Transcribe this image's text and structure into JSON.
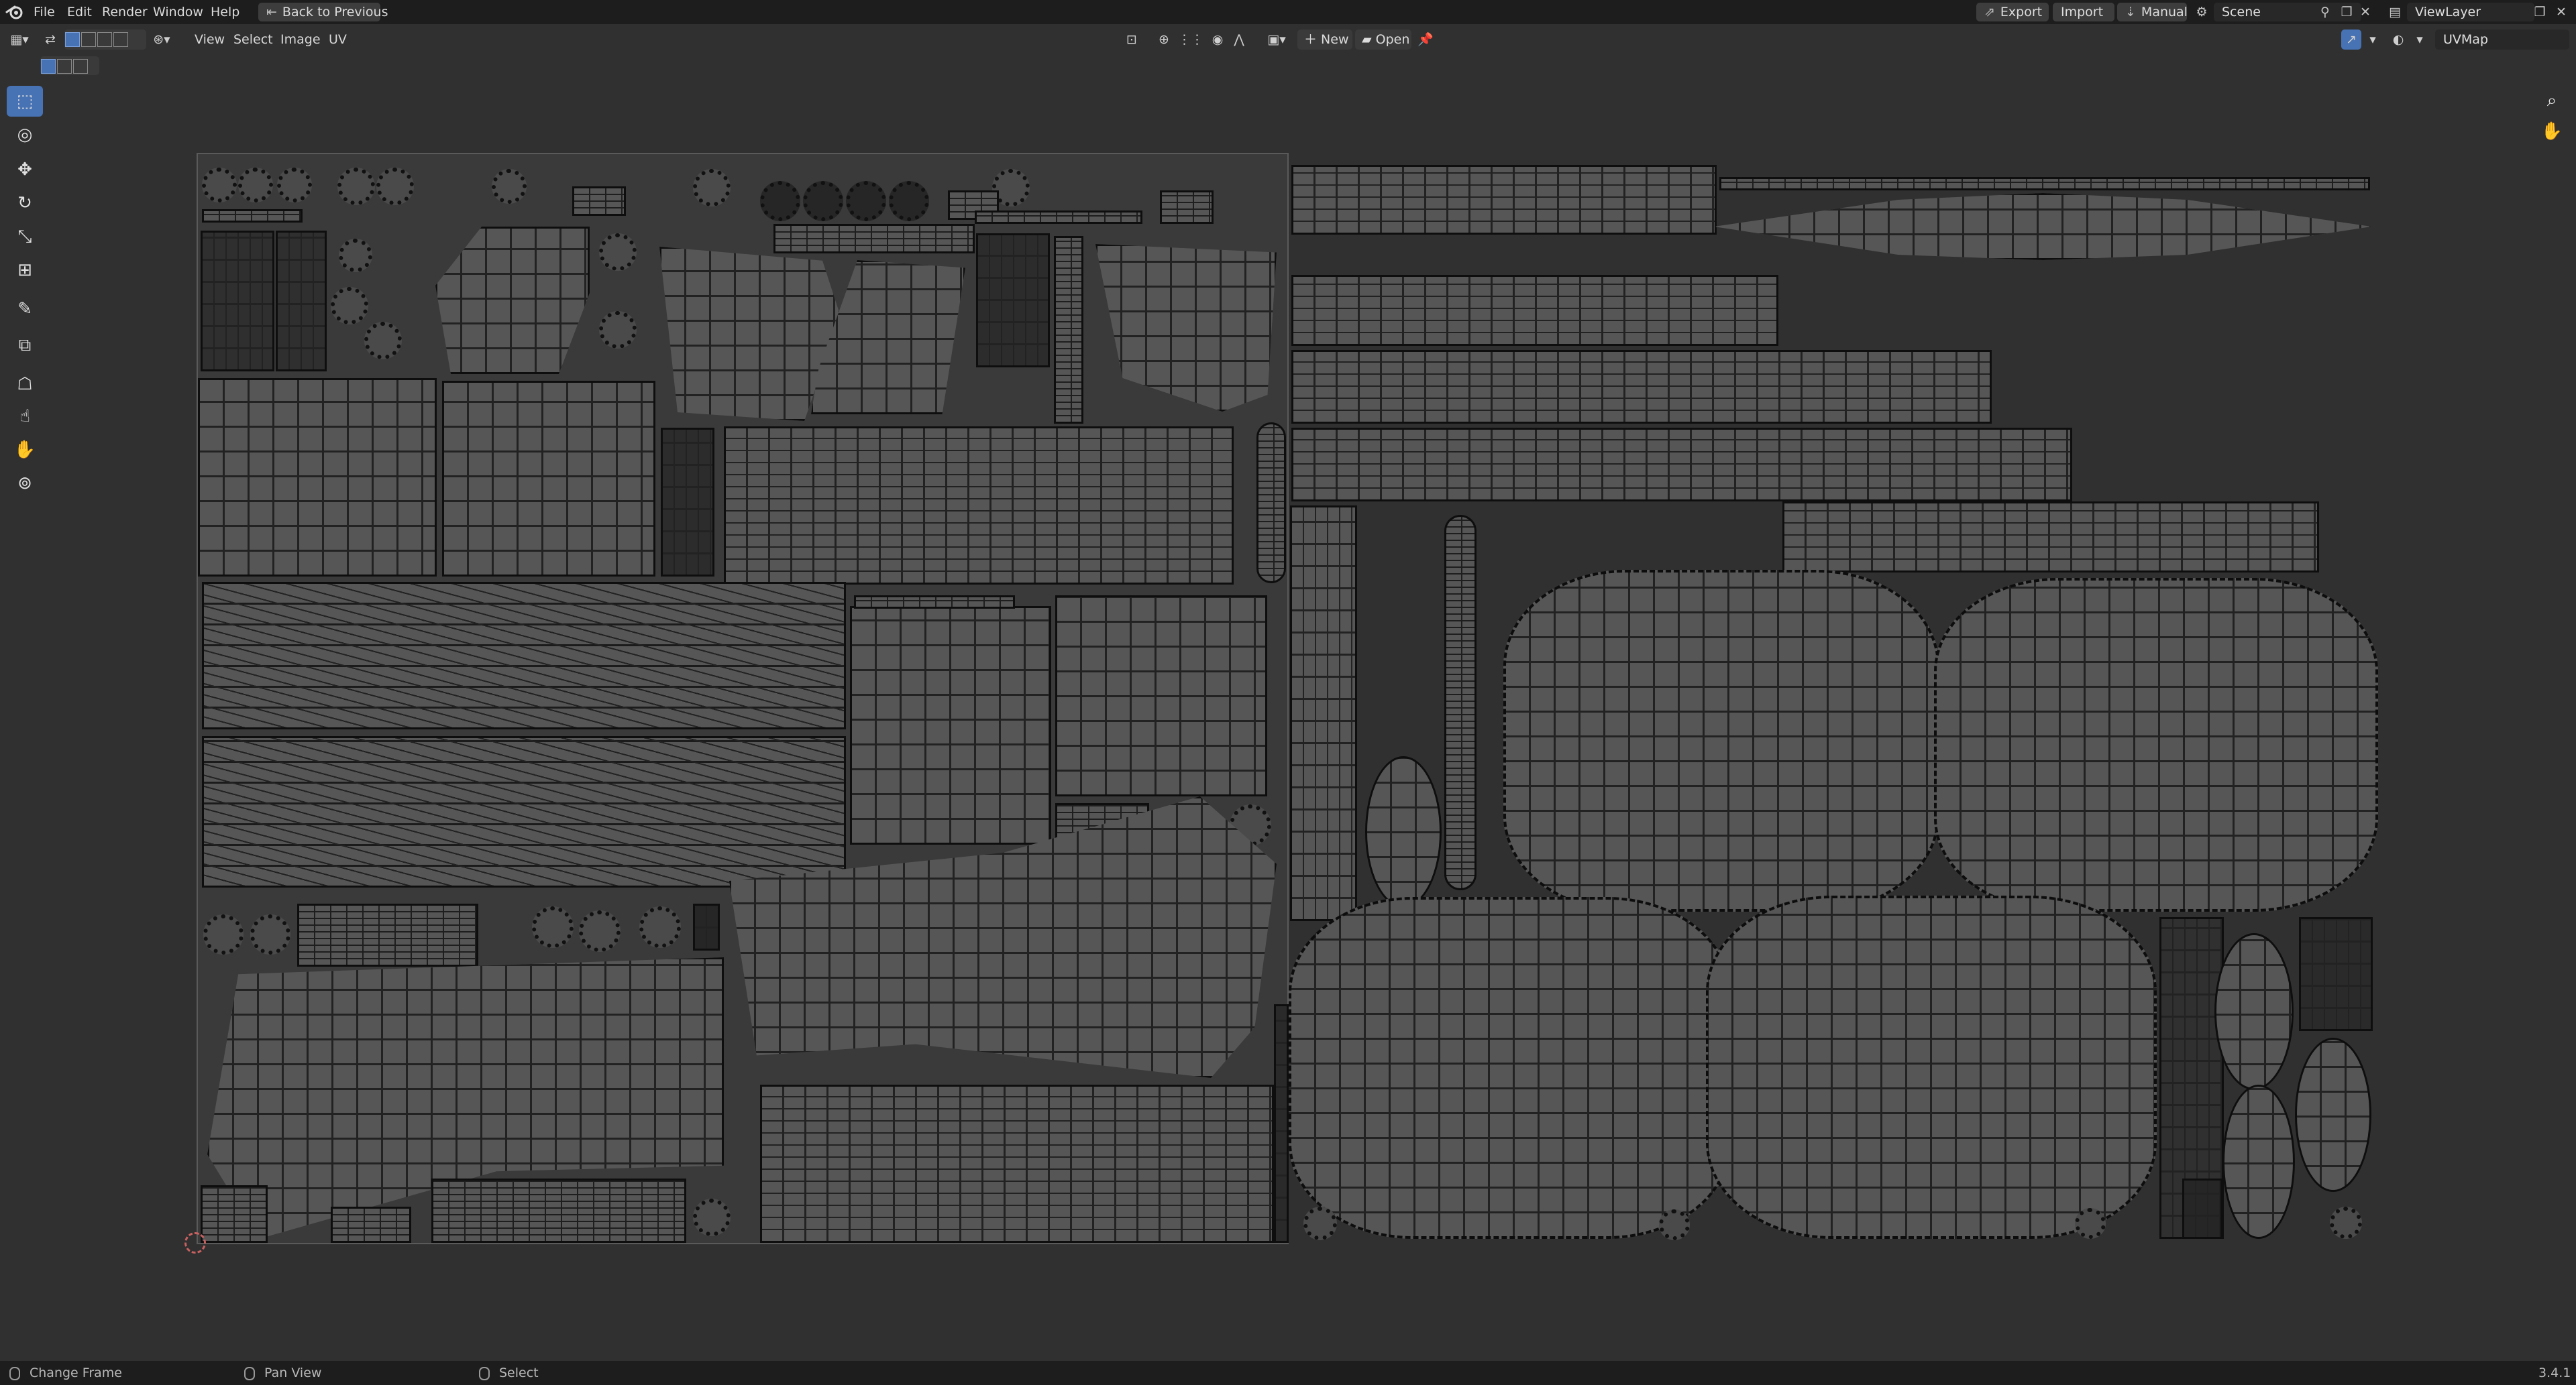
{
  "menubar": {
    "items": [
      "File",
      "Edit",
      "Render",
      "Window",
      "Help"
    ],
    "back_to_previous": "Back to Previous",
    "export": "Export",
    "import": "Import",
    "manual": "Manual",
    "scene": "Scene",
    "view_layer": "ViewLayer"
  },
  "editor_header": {
    "menus": [
      "View",
      "Select",
      "Image",
      "UV"
    ],
    "new_label": "New",
    "open_label": "Open",
    "uv_map": "UVMap"
  },
  "toolbar": {
    "tools": [
      {
        "name": "select-box-tool",
        "icon": "cursor-select-icon",
        "active": true
      },
      {
        "name": "cursor-tool",
        "icon": "3d-cursor-icon",
        "active": false
      },
      {
        "name": "move-tool",
        "icon": "move-icon",
        "active": false
      },
      {
        "name": "rotate-tool",
        "icon": "rotate-icon",
        "active": false
      },
      {
        "name": "scale-tool",
        "icon": "scale-icon",
        "active": false
      },
      {
        "name": "transform-tool",
        "icon": "transform-icon",
        "active": false
      },
      {
        "name": "annotate-tool",
        "icon": "annotate-pen-icon",
        "active": false
      },
      {
        "name": "rip-region-tool",
        "icon": "rip-region-icon",
        "active": false
      },
      {
        "name": "grab-tool",
        "icon": "grab-icon",
        "active": false
      },
      {
        "name": "relax-tool",
        "icon": "relax-icon",
        "active": false
      },
      {
        "name": "pinch-tool",
        "icon": "pinch-icon",
        "active": false
      },
      {
        "name": "sample-tool",
        "icon": "sample-icon",
        "active": false
      }
    ]
  },
  "status_bar": {
    "left": "Change Frame",
    "middle": "Pan View",
    "right": "Select",
    "version": "3.4.1"
  },
  "colors": {
    "accent": "#4772b3",
    "viewport_bg": "#303030",
    "bar_bg": "#1d1d1d",
    "island_fill": "#565656",
    "island_edge": "#0e0e0e"
  }
}
